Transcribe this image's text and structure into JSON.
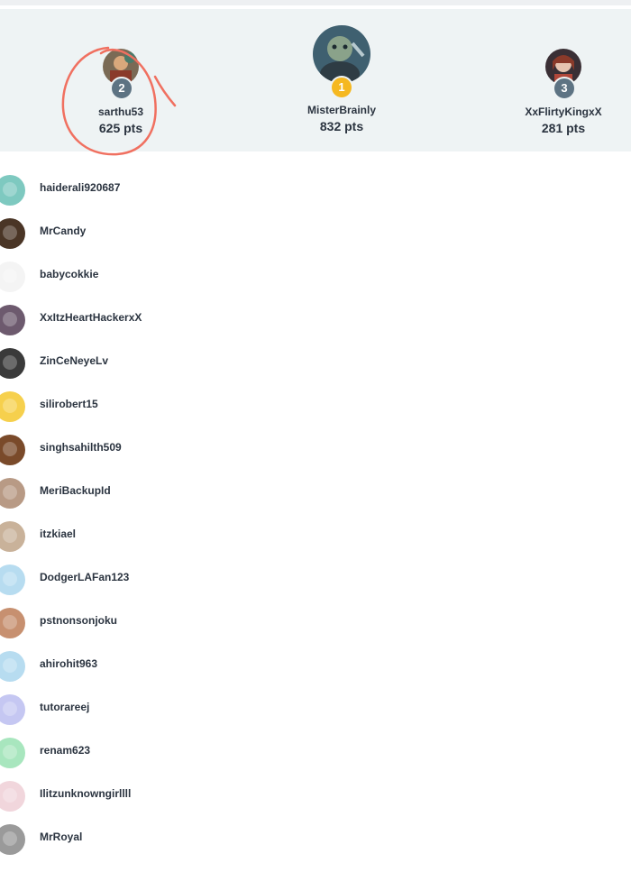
{
  "podium": {
    "first": {
      "rank": "1",
      "username": "MisterBrainly",
      "points": "832 pts",
      "rank_color": "#f5b820"
    },
    "second": {
      "rank": "2",
      "username": "sarthu53",
      "points": "625 pts",
      "rank_color": "#5d7383"
    },
    "third": {
      "rank": "3",
      "username": "XxFlirtyKingxX",
      "points": "281 pts",
      "rank_color": "#5d7383"
    }
  },
  "annotation": {
    "color": "#f07060"
  },
  "list": [
    {
      "username": "haiderali920687",
      "avatar_color": "#7ec9c0"
    },
    {
      "username": "MrCandy",
      "avatar_color": "#4a3526"
    },
    {
      "username": "babycokkie",
      "avatar_color": "#f4f4f4"
    },
    {
      "username": "XxItzHeartHackerxX",
      "avatar_color": "#6d5a6e"
    },
    {
      "username": "ZinCeNeyeLv",
      "avatar_color": "#3a3a3a"
    },
    {
      "username": "silirobert15",
      "avatar_color": "#f6d04d"
    },
    {
      "username": "singhsahilth509",
      "avatar_color": "#7a4a2a"
    },
    {
      "username": "MeriBackupId",
      "avatar_color": "#b89a85"
    },
    {
      "username": "itzkiael",
      "avatar_color": "#c9b29a"
    },
    {
      "username": "DodgerLAFan123",
      "avatar_color": "#b7dcf0"
    },
    {
      "username": "pstnonsonjoku",
      "avatar_color": "#c79070"
    },
    {
      "username": "ahirohit963",
      "avatar_color": "#b7dcf0"
    },
    {
      "username": "tutorareej",
      "avatar_color": "#c5c7f2"
    },
    {
      "username": "renam623",
      "avatar_color": "#a8e6be"
    },
    {
      "username": "Ilitzunknowngirllll",
      "avatar_color": "#f1d6dc"
    },
    {
      "username": "MrRoyal",
      "avatar_color": "#9a9a9a"
    }
  ]
}
